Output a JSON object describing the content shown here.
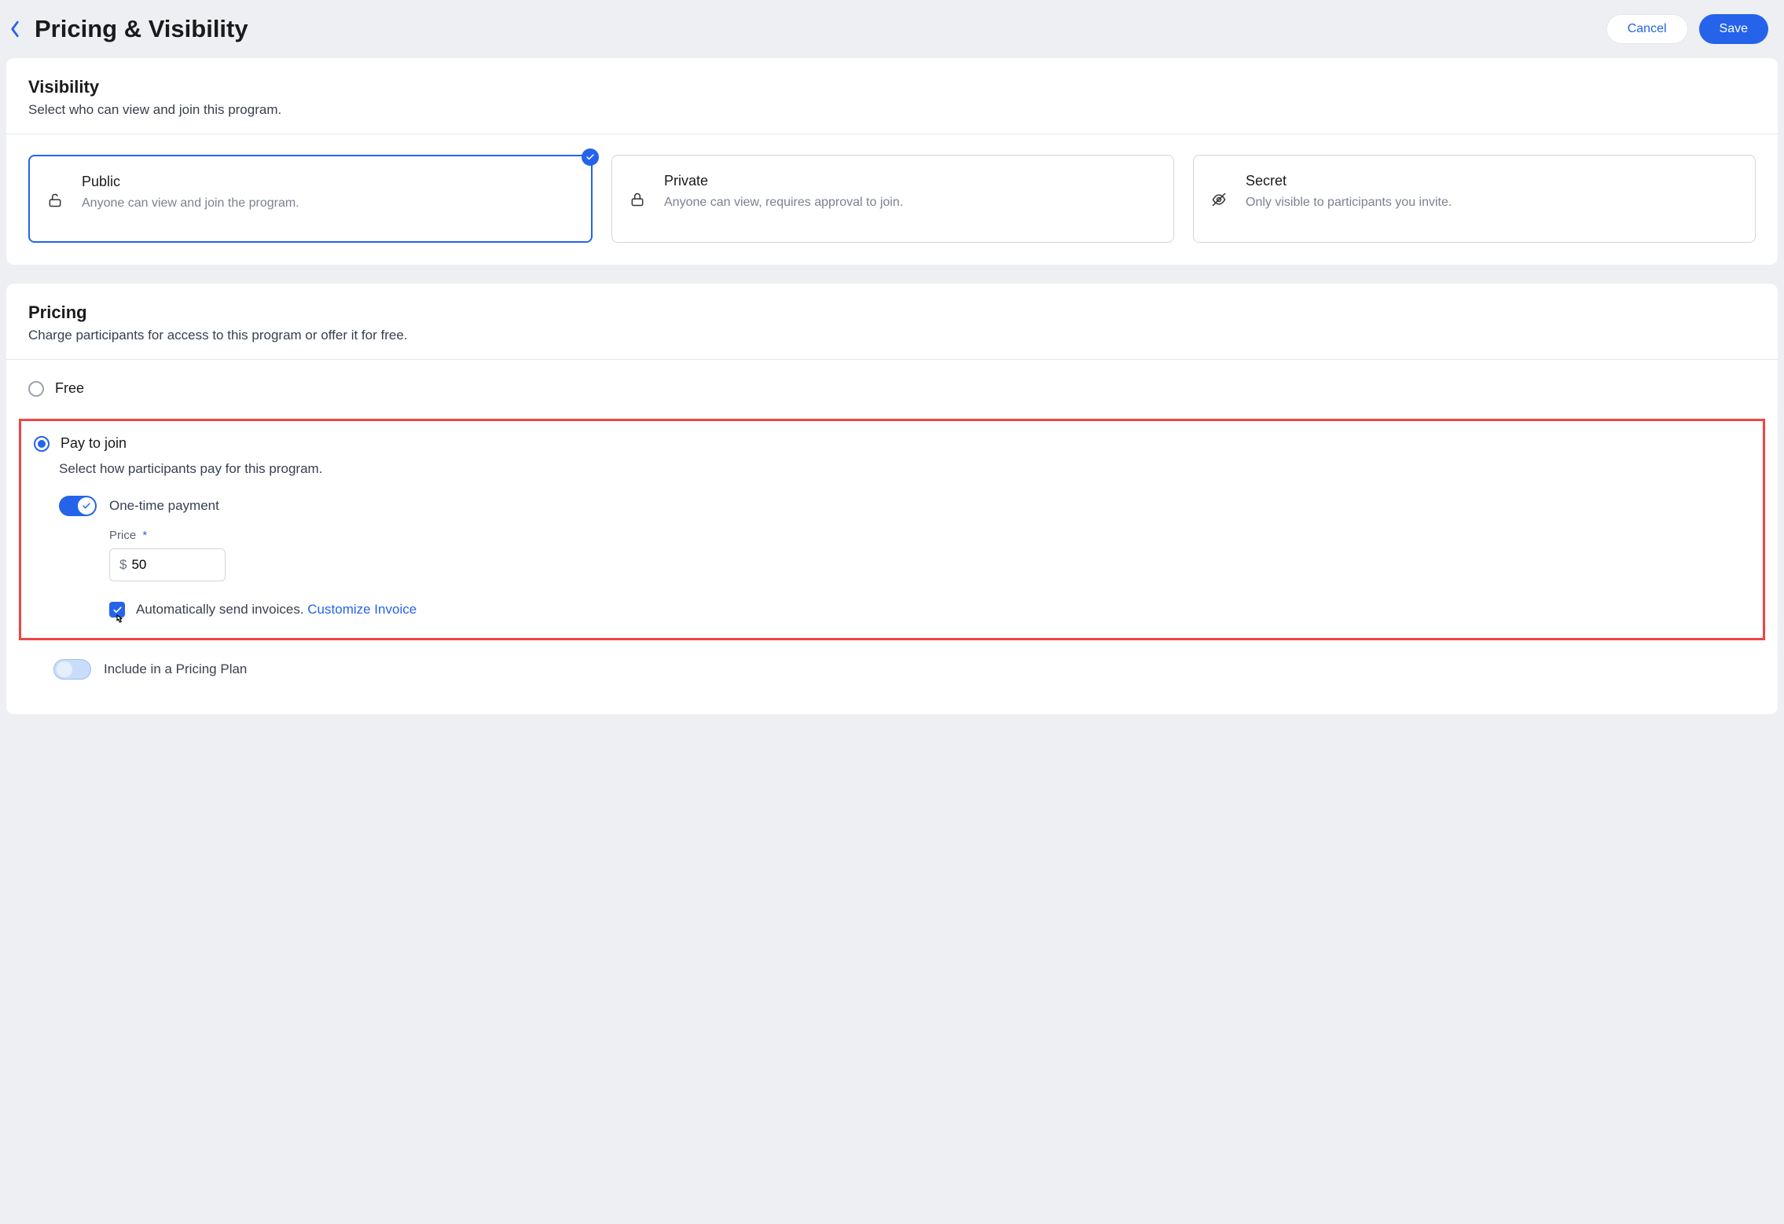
{
  "header": {
    "title": "Pricing & Visibility",
    "cancel": "Cancel",
    "save": "Save"
  },
  "visibility": {
    "title": "Visibility",
    "subtitle": "Select who can view and join this program.",
    "options": [
      {
        "title": "Public",
        "desc": "Anyone can view and join the program."
      },
      {
        "title": "Private",
        "desc": "Anyone can view, requires approval to join."
      },
      {
        "title": "Secret",
        "desc": "Only visible to participants you invite."
      }
    ]
  },
  "pricing": {
    "title": "Pricing",
    "subtitle": "Charge participants for access to this program or offer it for free.",
    "free_label": "Free",
    "pay_label": "Pay to join",
    "pay_sub": "Select how participants pay for this program.",
    "one_time_label": "One-time payment",
    "price_label": "Price",
    "required_mark": "*",
    "currency": "$",
    "price_value": "50",
    "auto_invoice_text": "Automatically send invoices. ",
    "customize_link": "Customize Invoice",
    "pricing_plan_label": "Include in a Pricing Plan"
  }
}
